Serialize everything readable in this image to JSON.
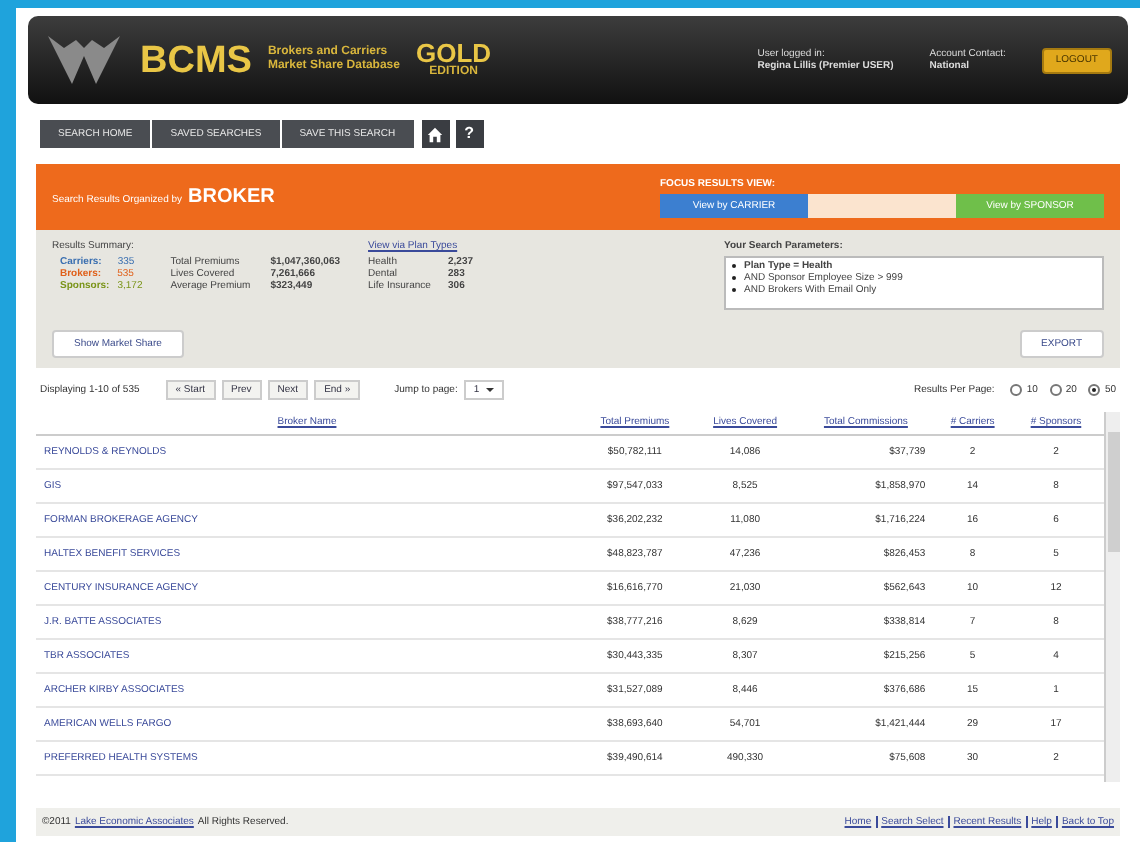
{
  "header": {
    "logo": "BCMS",
    "subtitle_lines": [
      "Brokers and Carriers",
      "Market Share Database"
    ],
    "edition_lines": [
      "GOLD",
      "EDITION"
    ],
    "user_label": "User logged in:",
    "user": "Regina Lillis (Premier USER)",
    "contact_label": "Account Contact:",
    "contact": "National",
    "logout": "LOGOUT"
  },
  "nav": {
    "buttons": [
      "SEARCH HOME",
      "SAVED SEARCHES",
      "SAVE THIS SEARCH"
    ],
    "help": "?"
  },
  "focus": {
    "title": "Search Results Organized by",
    "entity": "BROKER",
    "view_label": "FOCUS RESULTS VIEW:",
    "buttons": [
      {
        "label": "View by CARRIER",
        "kind": "carrier"
      },
      {
        "label": "View by SPONSOR",
        "kind": "sponsor"
      }
    ]
  },
  "summary": {
    "title": "Results Summary:",
    "counts": [
      {
        "label": "Carriers:",
        "value": "335",
        "color": "#3a6fb0"
      },
      {
        "label": "Brokers:",
        "value": "535",
        "color": "#e0601a"
      },
      {
        "label": "Sponsors:",
        "value": "3,172",
        "color": "#7a9418"
      }
    ],
    "totals": [
      {
        "label": "Total Premiums",
        "value": "$1,047,360,063"
      },
      {
        "label": "Lives Covered",
        "value": "7,261,666"
      },
      {
        "label": "Average Premium",
        "value": "$323,449"
      }
    ],
    "plan_link": "View via Plan Types",
    "plans": [
      {
        "label": "Health",
        "value": "2,237"
      },
      {
        "label": "Dental",
        "value": "283"
      },
      {
        "label": "Life Insurance",
        "value": "306"
      }
    ],
    "params_title": "Your Search Parameters:",
    "params": [
      "**Plan Type = Health**",
      "AND Sponsor Employee Size > 999",
      "AND Brokers With Email Only"
    ],
    "market_share": "Show Market Share",
    "export": "EXPORT"
  },
  "pager": {
    "display": "Displaying 1-10 of 535",
    "buttons": [
      "« Start",
      "Prev",
      "Next",
      "End »"
    ],
    "jump_label": "Jump to page:",
    "page": "1",
    "per_page_label": "Results Per Page:",
    "per_page": [
      {
        "label": "10",
        "selected": false
      },
      {
        "label": "20",
        "selected": false
      },
      {
        "label": "50",
        "selected": true
      }
    ]
  },
  "table": {
    "columns": [
      "Broker Name",
      "Total Premiums",
      "Lives Covered",
      "Total Commissions",
      "# Carriers",
      "# Sponsors"
    ],
    "rows": [
      [
        "REYNOLDS & REYNOLDS",
        "$50,782,111",
        "14,086",
        "$37,739",
        "2",
        "2"
      ],
      [
        "GIS",
        "$97,547,033",
        "8,525",
        "$1,858,970",
        "14",
        "8"
      ],
      [
        "FORMAN BROKERAGE AGENCY",
        "$36,202,232",
        "11,080",
        "$1,716,224",
        "16",
        "6"
      ],
      [
        "HALTEX BENEFIT SERVICES",
        "$48,823,787",
        "47,236",
        "$826,453",
        "8",
        "5"
      ],
      [
        "CENTURY INSURANCE AGENCY",
        "$16,616,770",
        "21,030",
        "$562,643",
        "10",
        "12"
      ],
      [
        "J.R. BATTE ASSOCIATES",
        "$38,777,216",
        "8,629",
        "$338,814",
        "7",
        "8"
      ],
      [
        "TBR ASSOCIATES",
        "$30,443,335",
        "8,307",
        "$215,256",
        "5",
        "4"
      ],
      [
        "ARCHER KIRBY ASSOCIATES",
        "$31,527,089",
        "8,446",
        "$376,686",
        "15",
        "1"
      ],
      [
        "AMERICAN WELLS FARGO",
        "$38,693,640",
        "54,701",
        "$1,421,444",
        "29",
        "17"
      ],
      [
        "PREFERRED HEALTH SYSTEMS",
        "$39,490,614",
        "490,330",
        "$75,608",
        "30",
        "2"
      ]
    ]
  },
  "footer": {
    "copyright": "©2011",
    "company": "Lake Economic Associates",
    "rights": "All Rights Reserved.",
    "links": [
      "Home",
      "Search Select",
      "Recent Results",
      "Help",
      "Back to Top"
    ]
  }
}
